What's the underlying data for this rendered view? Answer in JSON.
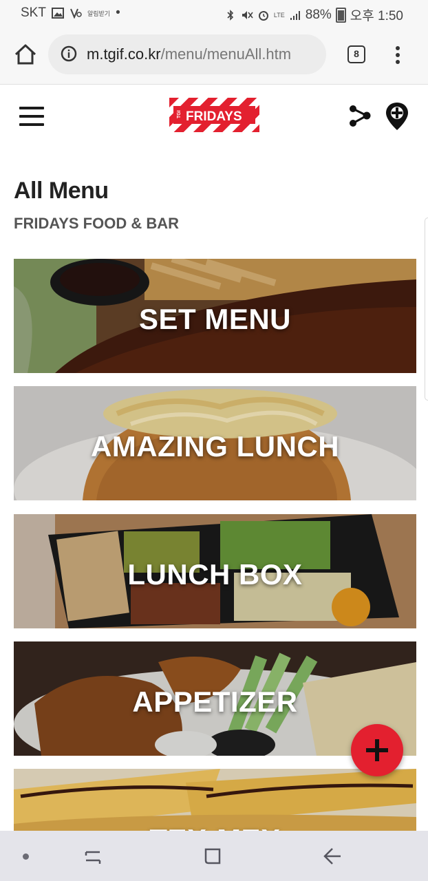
{
  "status_bar": {
    "carrier": "SKT",
    "small_label": "알림받기",
    "network": "LTE",
    "battery": "88%",
    "time": "오후 1:50"
  },
  "browser": {
    "url_host": "m.tgif.co.kr",
    "url_path": "/menu/menuAll.htm",
    "tab_count": "8"
  },
  "site": {
    "logo_text": "FRIDAYS",
    "logo_prefix": "TGI"
  },
  "page": {
    "title": "All Menu",
    "subtitle": "FRIDAYS FOOD & BAR"
  },
  "menu": [
    {
      "label": "SET MENU"
    },
    {
      "label": "AMAZING LUNCH"
    },
    {
      "label": "LUNCH BOX"
    },
    {
      "label": "APPETIZER"
    },
    {
      "label": "TEX-MEX"
    }
  ],
  "colors": {
    "brand_red": "#e3202f",
    "fab": "#e3202f"
  }
}
